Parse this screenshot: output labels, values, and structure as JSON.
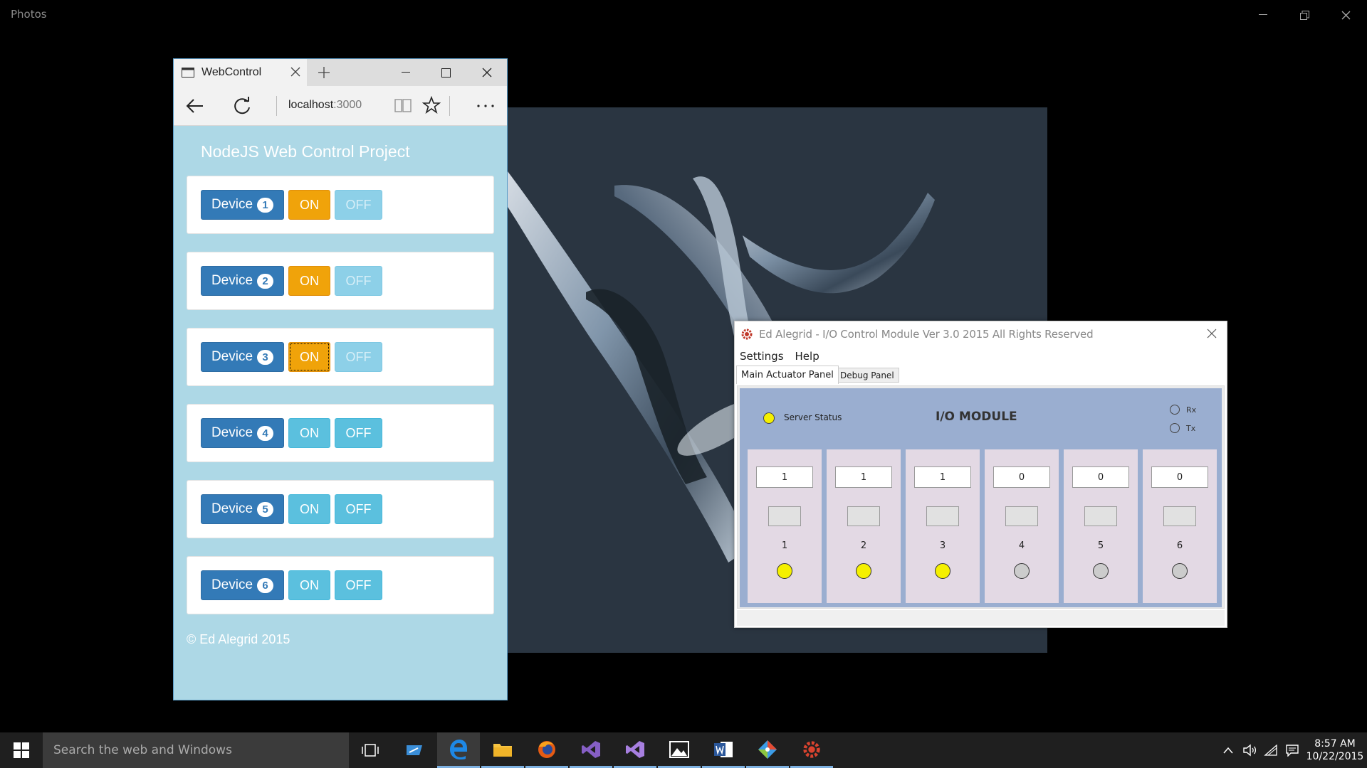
{
  "photos_app": {
    "title": "Photos"
  },
  "browser": {
    "tab_title": "WebControl",
    "address_host": "localhost",
    "address_port": ":3000",
    "page_title": "NodeJS Web Control Project",
    "device_label": "Device",
    "on_label": "ON",
    "off_label": "OFF",
    "devices": [
      {
        "number": "1",
        "state": "on"
      },
      {
        "number": "2",
        "state": "on"
      },
      {
        "number": "3",
        "state": "on"
      },
      {
        "number": "4",
        "state": "off"
      },
      {
        "number": "5",
        "state": "off"
      },
      {
        "number": "6",
        "state": "off"
      }
    ],
    "footer": "© Ed Alegrid 2015"
  },
  "io_module": {
    "title": "Ed Alegrid - I/O Control Module Ver 3.0 2015  All Rights Reserved",
    "menu": [
      "Settings",
      "Help"
    ],
    "tabs": [
      "Main Actuator Panel",
      "Debug Panel"
    ],
    "server_status_label": "Server Status",
    "heading": "I/O MODULE",
    "rx_label": "Rx",
    "tx_label": "Tx",
    "channels": [
      {
        "value": "1",
        "number": "1",
        "led": "on"
      },
      {
        "value": "1",
        "number": "2",
        "led": "on"
      },
      {
        "value": "1",
        "number": "3",
        "led": "on"
      },
      {
        "value": "0",
        "number": "4",
        "led": "off"
      },
      {
        "value": "0",
        "number": "5",
        "led": "off"
      },
      {
        "value": "0",
        "number": "6",
        "led": "off"
      }
    ]
  },
  "taskbar": {
    "search_placeholder": "Search the web and Windows",
    "apps": [
      "task-view",
      "azure",
      "edge",
      "file-explorer",
      "firefox",
      "visual-studio",
      "visual-studio-preview",
      "photos",
      "word",
      "git",
      "io-control-module"
    ],
    "time": "8:57 AM",
    "date": "10/22/2015"
  },
  "colors": {
    "device_button": "#337ab7",
    "on_active": "#f0a30a",
    "info_button": "#5bc0de",
    "page_bg": "#add8e6",
    "led_on": "#f5f000",
    "led_off": "#cccccc"
  }
}
